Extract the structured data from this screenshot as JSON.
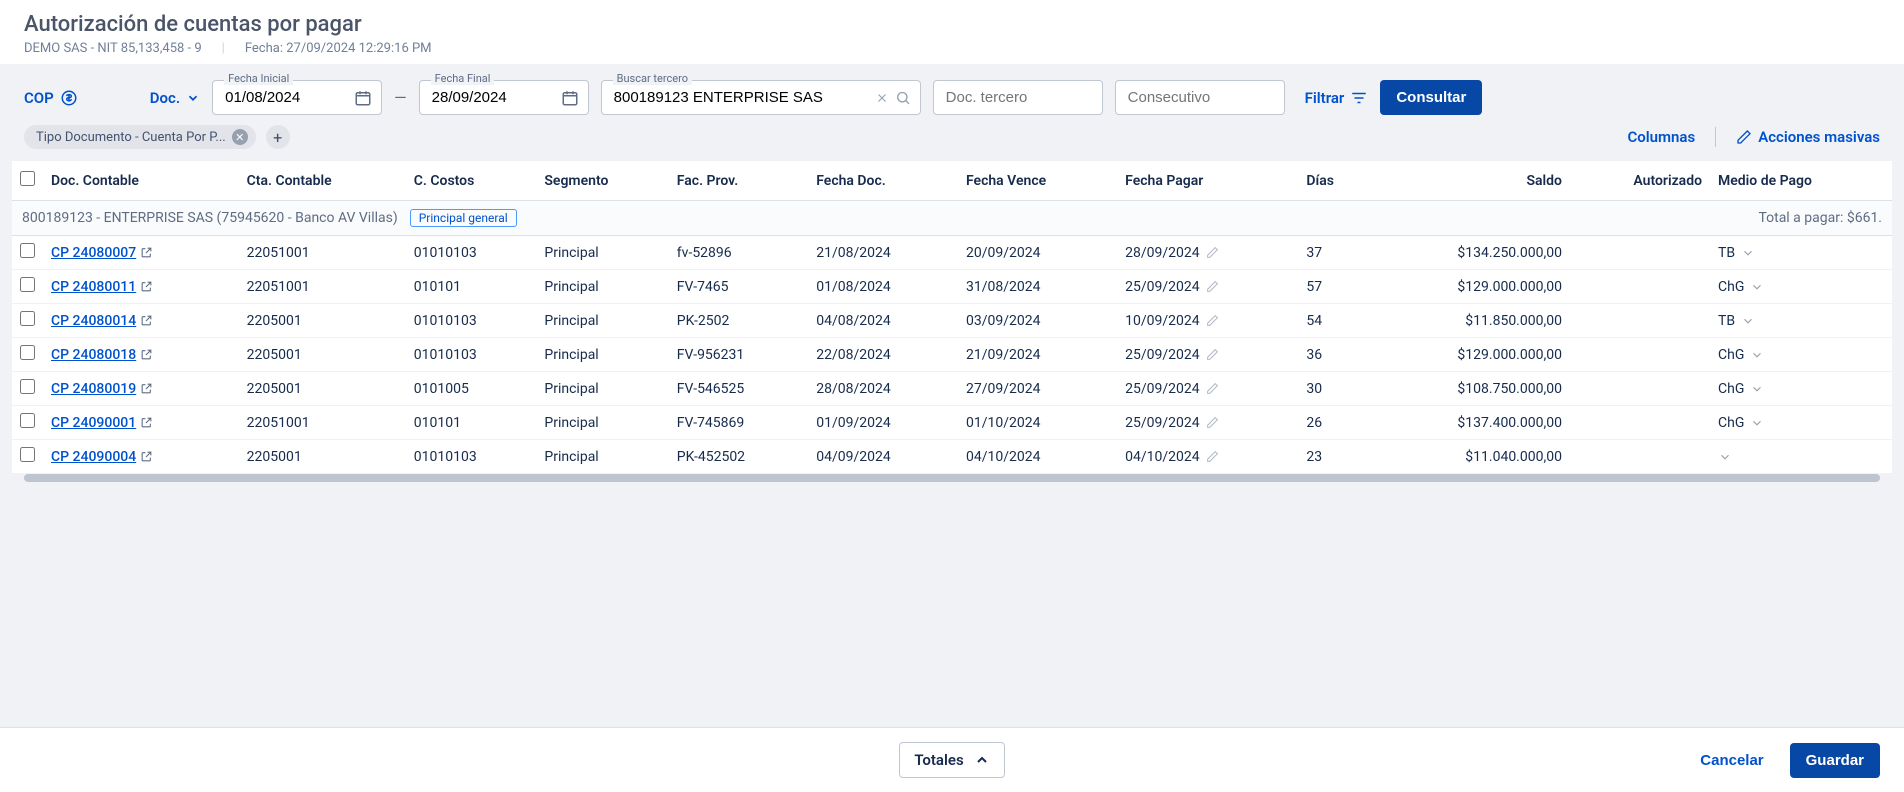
{
  "header": {
    "title": "Autorización de cuentas por pagar",
    "company": "DEMO SAS - NIT 85,133,458 - 9",
    "datetime_label": "Fecha: 27/09/2024 12:29:16 PM"
  },
  "filters": {
    "currency": "COP",
    "doc_label": "Doc.",
    "fecha_inicial_label": "Fecha Inicial",
    "fecha_inicial": "01/08/2024",
    "fecha_final_label": "Fecha Final",
    "fecha_final": "28/09/2024",
    "buscar_tercero_label": "Buscar tercero",
    "buscar_tercero": "800189123 ENTERPRISE SAS",
    "doc_tercero_placeholder": "Doc. tercero",
    "consecutivo_placeholder": "Consecutivo",
    "filtrar_label": "Filtrar",
    "consultar_label": "Consultar"
  },
  "chips": {
    "filter_chip": "Tipo Documento - Cuenta Por P...",
    "columnas": "Columnas",
    "acciones": "Acciones masivas"
  },
  "columns": {
    "doc_contable": "Doc. Contable",
    "cta_contable": "Cta. Contable",
    "c_costos": "C. Costos",
    "segmento": "Segmento",
    "fac_prov": "Fac. Prov.",
    "fecha_doc": "Fecha Doc.",
    "fecha_vence": "Fecha Vence",
    "fecha_pagar": "Fecha Pagar",
    "dias": "Días",
    "saldo": "Saldo",
    "autorizado": "Autorizado",
    "medio_pago": "Medio de Pago"
  },
  "group": {
    "title": "800189123 - ENTERPRISE SAS (75945620 - Banco AV Villas)",
    "badge": "Principal general",
    "total_label": "Total a pagar: $661."
  },
  "rows": [
    {
      "doc": "CP 24080007",
      "cta": "22051001",
      "cc": "01010103",
      "seg": "Principal",
      "fac": "fv-52896",
      "fdoc": "21/08/2024",
      "fven": "20/09/2024",
      "overdue": true,
      "fpag": "28/09/2024",
      "dias": "37",
      "saldo": "$134.250.000,00",
      "medio": "TB"
    },
    {
      "doc": "CP 24080011",
      "cta": "22051001",
      "cc": "010101",
      "seg": "Principal",
      "fac": "FV-7465",
      "fdoc": "01/08/2024",
      "fven": "31/08/2024",
      "overdue": true,
      "fpag": "25/09/2024",
      "dias": "57",
      "saldo": "$129.000.000,00",
      "medio": "ChG"
    },
    {
      "doc": "CP 24080014",
      "cta": "2205001",
      "cc": "01010103",
      "seg": "Principal",
      "fac": "PK-2502",
      "fdoc": "04/08/2024",
      "fven": "03/09/2024",
      "overdue": true,
      "fpag": "10/09/2024",
      "dias": "54",
      "saldo": "$11.850.000,00",
      "medio": "TB"
    },
    {
      "doc": "CP 24080018",
      "cta": "2205001",
      "cc": "01010103",
      "seg": "Principal",
      "fac": "FV-956231",
      "fdoc": "22/08/2024",
      "fven": "21/09/2024",
      "overdue": true,
      "fpag": "25/09/2024",
      "dias": "36",
      "saldo": "$129.000.000,00",
      "medio": "ChG"
    },
    {
      "doc": "CP 24080019",
      "cta": "2205001",
      "cc": "0101005",
      "seg": "Principal",
      "fac": "FV-546525",
      "fdoc": "28/08/2024",
      "fven": "27/09/2024",
      "overdue": true,
      "fpag": "25/09/2024",
      "dias": "30",
      "saldo": "$108.750.000,00",
      "medio": "ChG"
    },
    {
      "doc": "CP 24090001",
      "cta": "22051001",
      "cc": "010101",
      "seg": "Principal",
      "fac": "FV-745869",
      "fdoc": "01/09/2024",
      "fven": "01/10/2024",
      "overdue": false,
      "fpag": "25/09/2024",
      "dias": "26",
      "saldo": "$137.400.000,00",
      "medio": "ChG"
    },
    {
      "doc": "CP 24090004",
      "cta": "2205001",
      "cc": "01010103",
      "seg": "Principal",
      "fac": "PK-452502",
      "fdoc": "04/09/2024",
      "fven": "04/10/2024",
      "overdue": false,
      "fpag": "04/10/2024",
      "dias": "23",
      "saldo": "$11.040.000,00",
      "medio": ""
    }
  ],
  "footer": {
    "totales": "Totales",
    "cancelar": "Cancelar",
    "guardar": "Guardar"
  }
}
